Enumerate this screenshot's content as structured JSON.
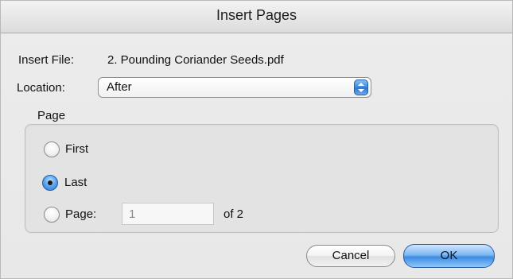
{
  "dialog": {
    "title": "Insert Pages",
    "insert_file_label": "Insert File:",
    "insert_file_value": "2. Pounding Coriander Seeds.pdf",
    "location_label": "Location:",
    "location_value": "After",
    "page_group_label": "Page",
    "radios": {
      "first_label": "First",
      "last_label": "Last",
      "page_label": "Page:",
      "selected": "Last"
    },
    "page_input_value": "1",
    "page_of_text": "of 2",
    "cancel_label": "Cancel",
    "ok_label": "OK"
  },
  "colors": {
    "accent": "#3d8be3",
    "background": "#e8e8e8"
  },
  "icons": {
    "popup_stepper": "up-down-chevron-icon"
  }
}
